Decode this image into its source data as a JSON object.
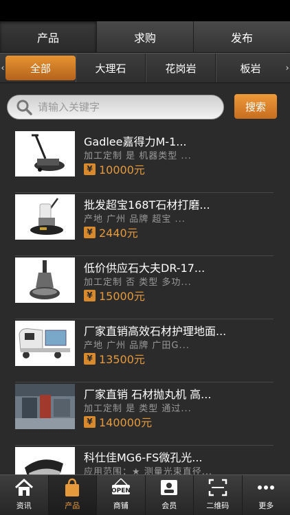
{
  "top_tabs": [
    "产品",
    "求购",
    "发布"
  ],
  "categories": [
    "全部",
    "大理石",
    "花岗岩",
    "板岩"
  ],
  "search": {
    "placeholder": "请输入关键字",
    "button": "搜索"
  },
  "products": [
    {
      "title": "Gadlee嘉得力M-1...",
      "specs": "加工定制  是  机器类型  ...",
      "currency": "¥",
      "price": "10000元"
    },
    {
      "title": "批发超宝168T石材打磨...",
      "specs": "产地  广州  品牌  超宝  ...",
      "currency": "¥",
      "price": "2440元"
    },
    {
      "title": "低价供应石大夫DR-17...",
      "specs": "加工定制  否  类型  多功...",
      "currency": "¥",
      "price": "15000元"
    },
    {
      "title": "厂家直销高效石材护理地面...",
      "specs": "产地  广州  品牌  广田G...",
      "currency": "¥",
      "price": "13500元"
    },
    {
      "title": "厂家直销 石材抛丸机 高...",
      "specs": "加工定制  是  类型  通过...",
      "currency": "¥",
      "price": "140000元"
    },
    {
      "title": "科仕佳MG6-FS微孔光...",
      "specs": "应用范围：★ 测量光束直径...",
      "currency": "¥",
      "price": ""
    }
  ],
  "bottom_nav": [
    "资讯",
    "产品",
    "商铺",
    "会员",
    "二维码",
    "更多"
  ],
  "icons": {
    "search": "magnifier-icon",
    "open_sign": "OPEN"
  },
  "colors": {
    "accent": "#e79a3c",
    "background": "#2b2b2b"
  }
}
